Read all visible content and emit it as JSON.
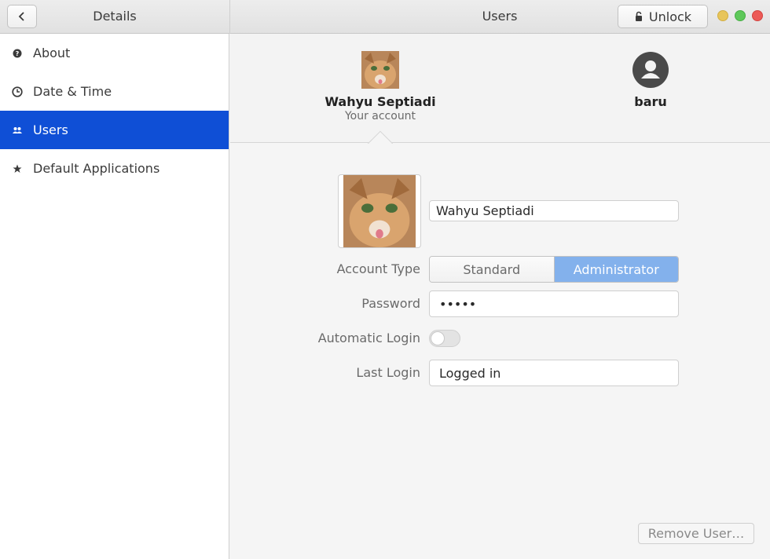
{
  "header": {
    "details_title": "Details",
    "users_title": "Users",
    "unlock_label": "Unlock",
    "back_icon": "chevron-left-icon",
    "lock_icon": "lock-icon"
  },
  "sidebar": {
    "items": [
      {
        "label": "About",
        "icon": "info-icon",
        "active": false
      },
      {
        "label": "Date & Time",
        "icon": "clock-icon",
        "active": false
      },
      {
        "label": "Users",
        "icon": "people-icon",
        "active": true
      },
      {
        "label": "Default Applications",
        "icon": "star-icon",
        "active": false
      }
    ],
    "active_color": "#0f4fd6"
  },
  "users": [
    {
      "name": "Wahyu Septiadi",
      "subtitle": "Your account",
      "avatar": "cat-photo",
      "selected": true
    },
    {
      "name": "baru",
      "subtitle": "",
      "avatar": "generic-user-icon",
      "selected": false
    }
  ],
  "details": {
    "full_name": "Wahyu Septiadi",
    "account_type_label": "Account Type",
    "account_type_options": [
      "Standard",
      "Administrator"
    ],
    "account_type_selected": "Administrator",
    "password_label": "Password",
    "password_value": "•••••",
    "auto_login_label": "Automatic Login",
    "auto_login_enabled": false,
    "last_login_label": "Last Login",
    "last_login_value": "Logged in",
    "remove_label": "Remove User…",
    "accent": "#83b1ec"
  }
}
